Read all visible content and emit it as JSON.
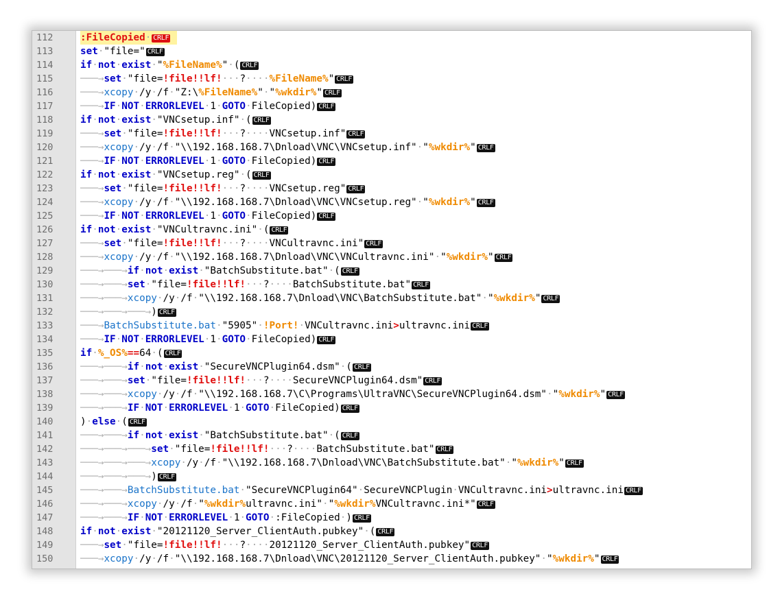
{
  "editor": {
    "eol_cr": "CR",
    "eol_lf": "LF",
    "lines": [
      {
        "n": "112",
        "t": "<span class='lbl'>:FileCopied</span><span class='dot'>·</span>"
      },
      {
        "n": "113",
        "t": "<span class='kw'>set</span><span class='dot'>·</span>\"file=\""
      },
      {
        "n": "114",
        "t": "<span class='kw'>if</span><span class='dot'>·</span><span class='kw'>not</span><span class='dot'>·</span><span class='kw'>exist</span><span class='dot'>·</span>\"<span class='var'>%FileName%</span>\"<span class='dot'>·</span>("
      },
      {
        "n": "115",
        "t": "<span class='tab'>───→</span><span class='kw'>set</span><span class='dot'>·</span>\"file=<span class='red'>!file!!lf!</span><span class='dot'>···</span>?<span class='dot'>····</span><span class='var'>%FileName%</span>\""
      },
      {
        "n": "116",
        "t": "<span class='tab'>───→</span><span class='cmd'>xcopy</span><span class='dot'>·</span>/y<span class='dot'>·</span>/f<span class='dot'>·</span>\"Z:\\<span class='var'>%FileName%</span>\"<span class='dot'>·</span>\"<span class='var'>%wkdir%</span>\""
      },
      {
        "n": "117",
        "t": "<span class='tab'>───→</span><span class='kw'>IF</span><span class='dot'>·</span><span class='kw'>NOT</span><span class='dot'>·</span><span class='kw'>ERRORLEVEL</span><span class='dot'>·</span>1<span class='dot'>·</span><span class='kw'>GOTO</span><span class='dot'>·</span>FileCopied)"
      },
      {
        "n": "118",
        "t": "<span class='kw'>if</span><span class='dot'>·</span><span class='kw'>not</span><span class='dot'>·</span><span class='kw'>exist</span><span class='dot'>·</span>\"VNCsetup.inf\"<span class='dot'>·</span>("
      },
      {
        "n": "119",
        "t": "<span class='tab'>───→</span><span class='kw'>set</span><span class='dot'>·</span>\"file=<span class='red'>!file!!lf!</span><span class='dot'>···</span>?<span class='dot'>····</span>VNCsetup.inf\""
      },
      {
        "n": "120",
        "t": "<span class='tab'>───→</span><span class='cmd'>xcopy</span><span class='dot'>·</span>/y<span class='dot'>·</span>/f<span class='dot'>·</span>\"\\\\192.168.168.7\\Dnload\\VNC\\VNCsetup.inf\"<span class='dot'>·</span>\"<span class='var'>%wkdir%</span>\""
      },
      {
        "n": "121",
        "t": "<span class='tab'>───→</span><span class='kw'>IF</span><span class='dot'>·</span><span class='kw'>NOT</span><span class='dot'>·</span><span class='kw'>ERRORLEVEL</span><span class='dot'>·</span>1<span class='dot'>·</span><span class='kw'>GOTO</span><span class='dot'>·</span>FileCopied)"
      },
      {
        "n": "122",
        "t": "<span class='kw'>if</span><span class='dot'>·</span><span class='kw'>not</span><span class='dot'>·</span><span class='kw'>exist</span><span class='dot'>·</span>\"VNCsetup.reg\"<span class='dot'>·</span>("
      },
      {
        "n": "123",
        "t": "<span class='tab'>───→</span><span class='kw'>set</span><span class='dot'>·</span>\"file=<span class='red'>!file!!lf!</span><span class='dot'>···</span>?<span class='dot'>····</span>VNCsetup.reg\""
      },
      {
        "n": "124",
        "t": "<span class='tab'>───→</span><span class='cmd'>xcopy</span><span class='dot'>·</span>/y<span class='dot'>·</span>/f<span class='dot'>·</span>\"\\\\192.168.168.7\\Dnload\\VNC\\VNCsetup.reg\"<span class='dot'>·</span>\"<span class='var'>%wkdir%</span>\""
      },
      {
        "n": "125",
        "t": "<span class='tab'>───→</span><span class='kw'>IF</span><span class='dot'>·</span><span class='kw'>NOT</span><span class='dot'>·</span><span class='kw'>ERRORLEVEL</span><span class='dot'>·</span>1<span class='dot'>·</span><span class='kw'>GOTO</span><span class='dot'>·</span>FileCopied)"
      },
      {
        "n": "126",
        "t": "<span class='kw'>if</span><span class='dot'>·</span><span class='kw'>not</span><span class='dot'>·</span><span class='kw'>exist</span><span class='dot'>·</span>\"VNCultravnc.ini\"<span class='dot'>·</span>("
      },
      {
        "n": "127",
        "t": "<span class='tab'>───→</span><span class='kw'>set</span><span class='dot'>·</span>\"file=<span class='red'>!file!!lf!</span><span class='dot'>···</span>?<span class='dot'>····</span>VNCultravnc.ini\""
      },
      {
        "n": "128",
        "t": "<span class='tab'>───→</span><span class='cmd'>xcopy</span><span class='dot'>·</span>/y<span class='dot'>·</span>/f<span class='dot'>·</span>\"\\\\192.168.168.7\\Dnload\\VNC\\VNCultravnc.ini\"<span class='dot'>·</span>\"<span class='var'>%wkdir%</span>\""
      },
      {
        "n": "129",
        "t": "<span class='tab'>───→───→</span><span class='kw'>if</span><span class='dot'>·</span><span class='kw'>not</span><span class='dot'>·</span><span class='kw'>exist</span><span class='dot'>·</span>\"BatchSubstitute.bat\"<span class='dot'>·</span>("
      },
      {
        "n": "130",
        "t": "<span class='tab'>───→───→</span><span class='kw'>set</span><span class='dot'>·</span>\"file=<span class='red'>!file!!lf!</span><span class='dot'>···</span>?<span class='dot'>····</span>BatchSubstitute.bat\""
      },
      {
        "n": "131",
        "t": "<span class='tab'>───→───→</span><span class='cmd'>xcopy</span><span class='dot'>·</span>/y<span class='dot'>·</span>/f<span class='dot'>·</span>\"\\\\192.168.168.7\\Dnload\\VNC\\BatchSubstitute.bat\"<span class='dot'>·</span>\"<span class='var'>%wkdir%</span>\""
      },
      {
        "n": "132",
        "t": "<span class='tab'>───→───→───→</span>)"
      },
      {
        "n": "133",
        "t": "<span class='tab'>───→</span><span class='cmd'>BatchSubstitute.bat</span><span class='dot'>·</span>\"5905\"<span class='dot'>·</span><span class='var'>!Port!</span><span class='dot'>·</span>VNCultravnc.ini<span class='red'>&gt;</span>ultravnc.ini"
      },
      {
        "n": "134",
        "t": "<span class='tab'>───→</span><span class='kw'>IF</span><span class='dot'>·</span><span class='kw'>NOT</span><span class='dot'>·</span><span class='kw'>ERRORLEVEL</span><span class='dot'>·</span>1<span class='dot'>·</span><span class='kw'>GOTO</span><span class='dot'>·</span>FileCopied)"
      },
      {
        "n": "135",
        "t": "<span class='kw'>if</span><span class='dot'>·</span><span class='var'>%_OS%</span><span class='red'>==</span>64<span class='dot'>·</span>("
      },
      {
        "n": "136",
        "t": "<span class='tab'>───→───→</span><span class='kw'>if</span><span class='dot'>·</span><span class='kw'>not</span><span class='dot'>·</span><span class='kw'>exist</span><span class='dot'>·</span>\"SecureVNCPlugin64.dsm\"<span class='dot'>·</span>("
      },
      {
        "n": "137",
        "t": "<span class='tab'>───→───→</span><span class='kw'>set</span><span class='dot'>·</span>\"file=<span class='red'>!file!!lf!</span><span class='dot'>···</span>?<span class='dot'>····</span>SecureVNCPlugin64.dsm\""
      },
      {
        "n": "138",
        "t": "<span class='tab'>───→───→</span><span class='cmd'>xcopy</span><span class='dot'>·</span>/y<span class='dot'>·</span>/f<span class='dot'>·</span>\"\\\\192.168.168.7\\C\\Programs\\UltraVNC\\SecureVNCPlugin64.dsm\"<span class='dot'>·</span>\"<span class='var'>%wkdir%</span>\""
      },
      {
        "n": "139",
        "t": "<span class='tab'>───→───→</span><span class='kw'>IF</span><span class='dot'>·</span><span class='kw'>NOT</span><span class='dot'>·</span><span class='kw'>ERRORLEVEL</span><span class='dot'>·</span>1<span class='dot'>·</span><span class='kw'>GOTO</span><span class='dot'>·</span>FileCopied)"
      },
      {
        "n": "140",
        "t": ")<span class='dot'>·</span><span class='kw'>else</span><span class='dot'>·</span>("
      },
      {
        "n": "141",
        "t": "<span class='tab'>───→───→</span><span class='kw'>if</span><span class='dot'>·</span><span class='kw'>not</span><span class='dot'>·</span><span class='kw'>exist</span><span class='dot'>·</span>\"BatchSubstitute.bat\"<span class='dot'>·</span>("
      },
      {
        "n": "142",
        "t": "<span class='tab'>───→───→───→</span><span class='kw'>set</span><span class='dot'>·</span>\"file=<span class='red'>!file!!lf!</span><span class='dot'>···</span>?<span class='dot'>····</span>BatchSubstitute.bat\""
      },
      {
        "n": "143",
        "t": "<span class='tab'>───→───→───→</span><span class='cmd'>xcopy</span><span class='dot'>·</span>/y<span class='dot'>·</span>/f<span class='dot'>·</span>\"\\\\192.168.168.7\\Dnload\\VNC\\BatchSubstitute.bat\"<span class='dot'>·</span>\"<span class='var'>%wkdir%</span>\""
      },
      {
        "n": "144",
        "t": "<span class='tab'>───→───→───→</span>)"
      },
      {
        "n": "145",
        "t": "<span class='tab'>───→───→</span><span class='cmd'>BatchSubstitute.bat</span><span class='dot'>·</span>\"SecureVNCPlugin64\"<span class='dot'>·</span>SecureVNCPlugin<span class='dot'>·</span>VNCultravnc.ini<span class='red'>&gt;</span>ultravnc.ini"
      },
      {
        "n": "146",
        "t": "<span class='tab'>───→───→</span><span class='cmd'>xcopy</span><span class='dot'>·</span>/y<span class='dot'>·</span>/f<span class='dot'>·</span>\"<span class='var'>%wkdir%</span>ultravnc.ini\"<span class='dot'>·</span>\"<span class='var'>%wkdir%</span>VNCultravnc.ini*\""
      },
      {
        "n": "147",
        "t": "<span class='tab'>───→───→</span><span class='kw'>IF</span><span class='dot'>·</span><span class='kw'>NOT</span><span class='dot'>·</span><span class='kw'>ERRORLEVEL</span><span class='dot'>·</span>1<span class='dot'>·</span><span class='kw'>GOTO</span><span class='dot'>·</span>:FileCopied<span class='dot'>·</span>)"
      },
      {
        "n": "148",
        "t": "<span class='kw'>if</span><span class='dot'>·</span><span class='kw'>not</span><span class='dot'>·</span><span class='kw'>exist</span><span class='dot'>·</span>\"20121120_Server_ClientAuth.pubkey\"<span class='dot'>·</span>("
      },
      {
        "n": "149",
        "t": "<span class='tab'>───→</span><span class='kw'>set</span><span class='dot'>·</span>\"file=<span class='red'>!file!!lf!</span><span class='dot'>···</span>?<span class='dot'>····</span>20121120_Server_ClientAuth.pubkey\""
      },
      {
        "n": "150",
        "t": "<span class='tab'>───→</span><span class='cmd'>xcopy</span><span class='dot'>·</span>/y<span class='dot'>·</span>/f<span class='dot'>·</span>\"\\\\192.168.168.7\\Dnload\\VNC\\20121120_Server_ClientAuth.pubkey\"<span class='dot'>·</span>\"<span class='var'>%wkdir%</span>\""
      }
    ]
  }
}
